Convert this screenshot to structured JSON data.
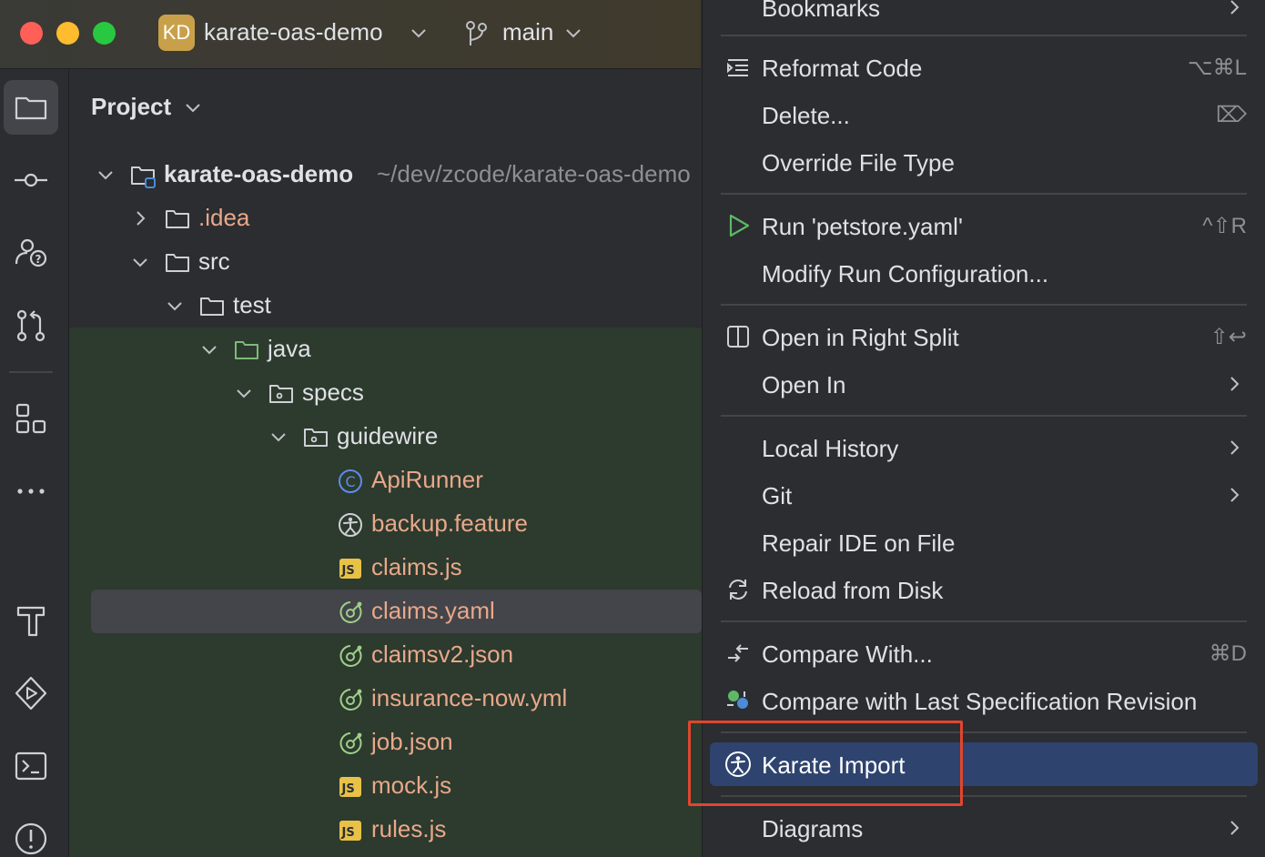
{
  "titlebar": {
    "project_badge": "KD",
    "project_name": "karate-oas-demo",
    "branch": "main"
  },
  "panel": {
    "title": "Project"
  },
  "tree": [
    {
      "label": "karate-oas-demo",
      "path": "~/dev/zcode/karate-oas-demo",
      "icon": "module-folder-icon",
      "expanded": true,
      "depth": 0
    },
    {
      "label": ".idea",
      "icon": "folder-icon",
      "expanded": false,
      "depth": 1,
      "color": "orange"
    },
    {
      "label": "src",
      "icon": "folder-icon",
      "expanded": true,
      "depth": 1
    },
    {
      "label": "test",
      "icon": "folder-icon",
      "expanded": true,
      "depth": 2
    },
    {
      "label": "java",
      "icon": "source-folder-icon",
      "expanded": true,
      "depth": 3
    },
    {
      "label": "specs",
      "icon": "package-icon",
      "expanded": true,
      "depth": 4
    },
    {
      "label": "guidewire",
      "icon": "package-icon",
      "expanded": true,
      "depth": 5
    },
    {
      "label": "ApiRunner",
      "icon": "class-icon",
      "depth": 6,
      "color": "orange"
    },
    {
      "label": "backup.feature",
      "icon": "karate-icon",
      "depth": 6,
      "color": "orange"
    },
    {
      "label": "claims.js",
      "icon": "js-icon",
      "depth": 6,
      "color": "orange"
    },
    {
      "label": "claims.yaml",
      "icon": "openapi-icon",
      "depth": 6,
      "color": "orange",
      "selected": true
    },
    {
      "label": "claimsv2.json",
      "icon": "openapi-icon",
      "depth": 6,
      "color": "orange"
    },
    {
      "label": "insurance-now.yml",
      "icon": "openapi-icon",
      "depth": 6,
      "color": "orange"
    },
    {
      "label": "job.json",
      "icon": "openapi-icon",
      "depth": 6,
      "color": "orange"
    },
    {
      "label": "mock.js",
      "icon": "js-icon",
      "depth": 6,
      "color": "orange"
    },
    {
      "label": "rules.js",
      "icon": "js-icon",
      "depth": 6,
      "color": "orange"
    }
  ],
  "menu": {
    "bookmarks": "Bookmarks",
    "reformat": {
      "label": "Reformat Code",
      "shortcut": "⌥⌘L"
    },
    "delete": {
      "label": "Delete...",
      "shortcut": "⌦"
    },
    "override": "Override File Type",
    "run": {
      "label": "Run 'petstore.yaml'",
      "shortcut": "^⇧R"
    },
    "modify_run": "Modify Run Configuration...",
    "open_right": {
      "label": "Open in Right Split",
      "shortcut": "⇧↩"
    },
    "open_in": "Open In",
    "local_history": "Local History",
    "git": "Git",
    "repair": "Repair IDE on File",
    "reload": "Reload from Disk",
    "compare": {
      "label": "Compare With...",
      "shortcut": "⌘D"
    },
    "compare_spec": "Compare with Last Specification Revision",
    "karate_import": "Karate Import",
    "diagrams": "Diagrams"
  },
  "colors": {
    "highlight": "#2e436e",
    "annotation": "#e0462e",
    "tree_orange": "#e8a88a",
    "green_zone": "#2d3a2e"
  }
}
